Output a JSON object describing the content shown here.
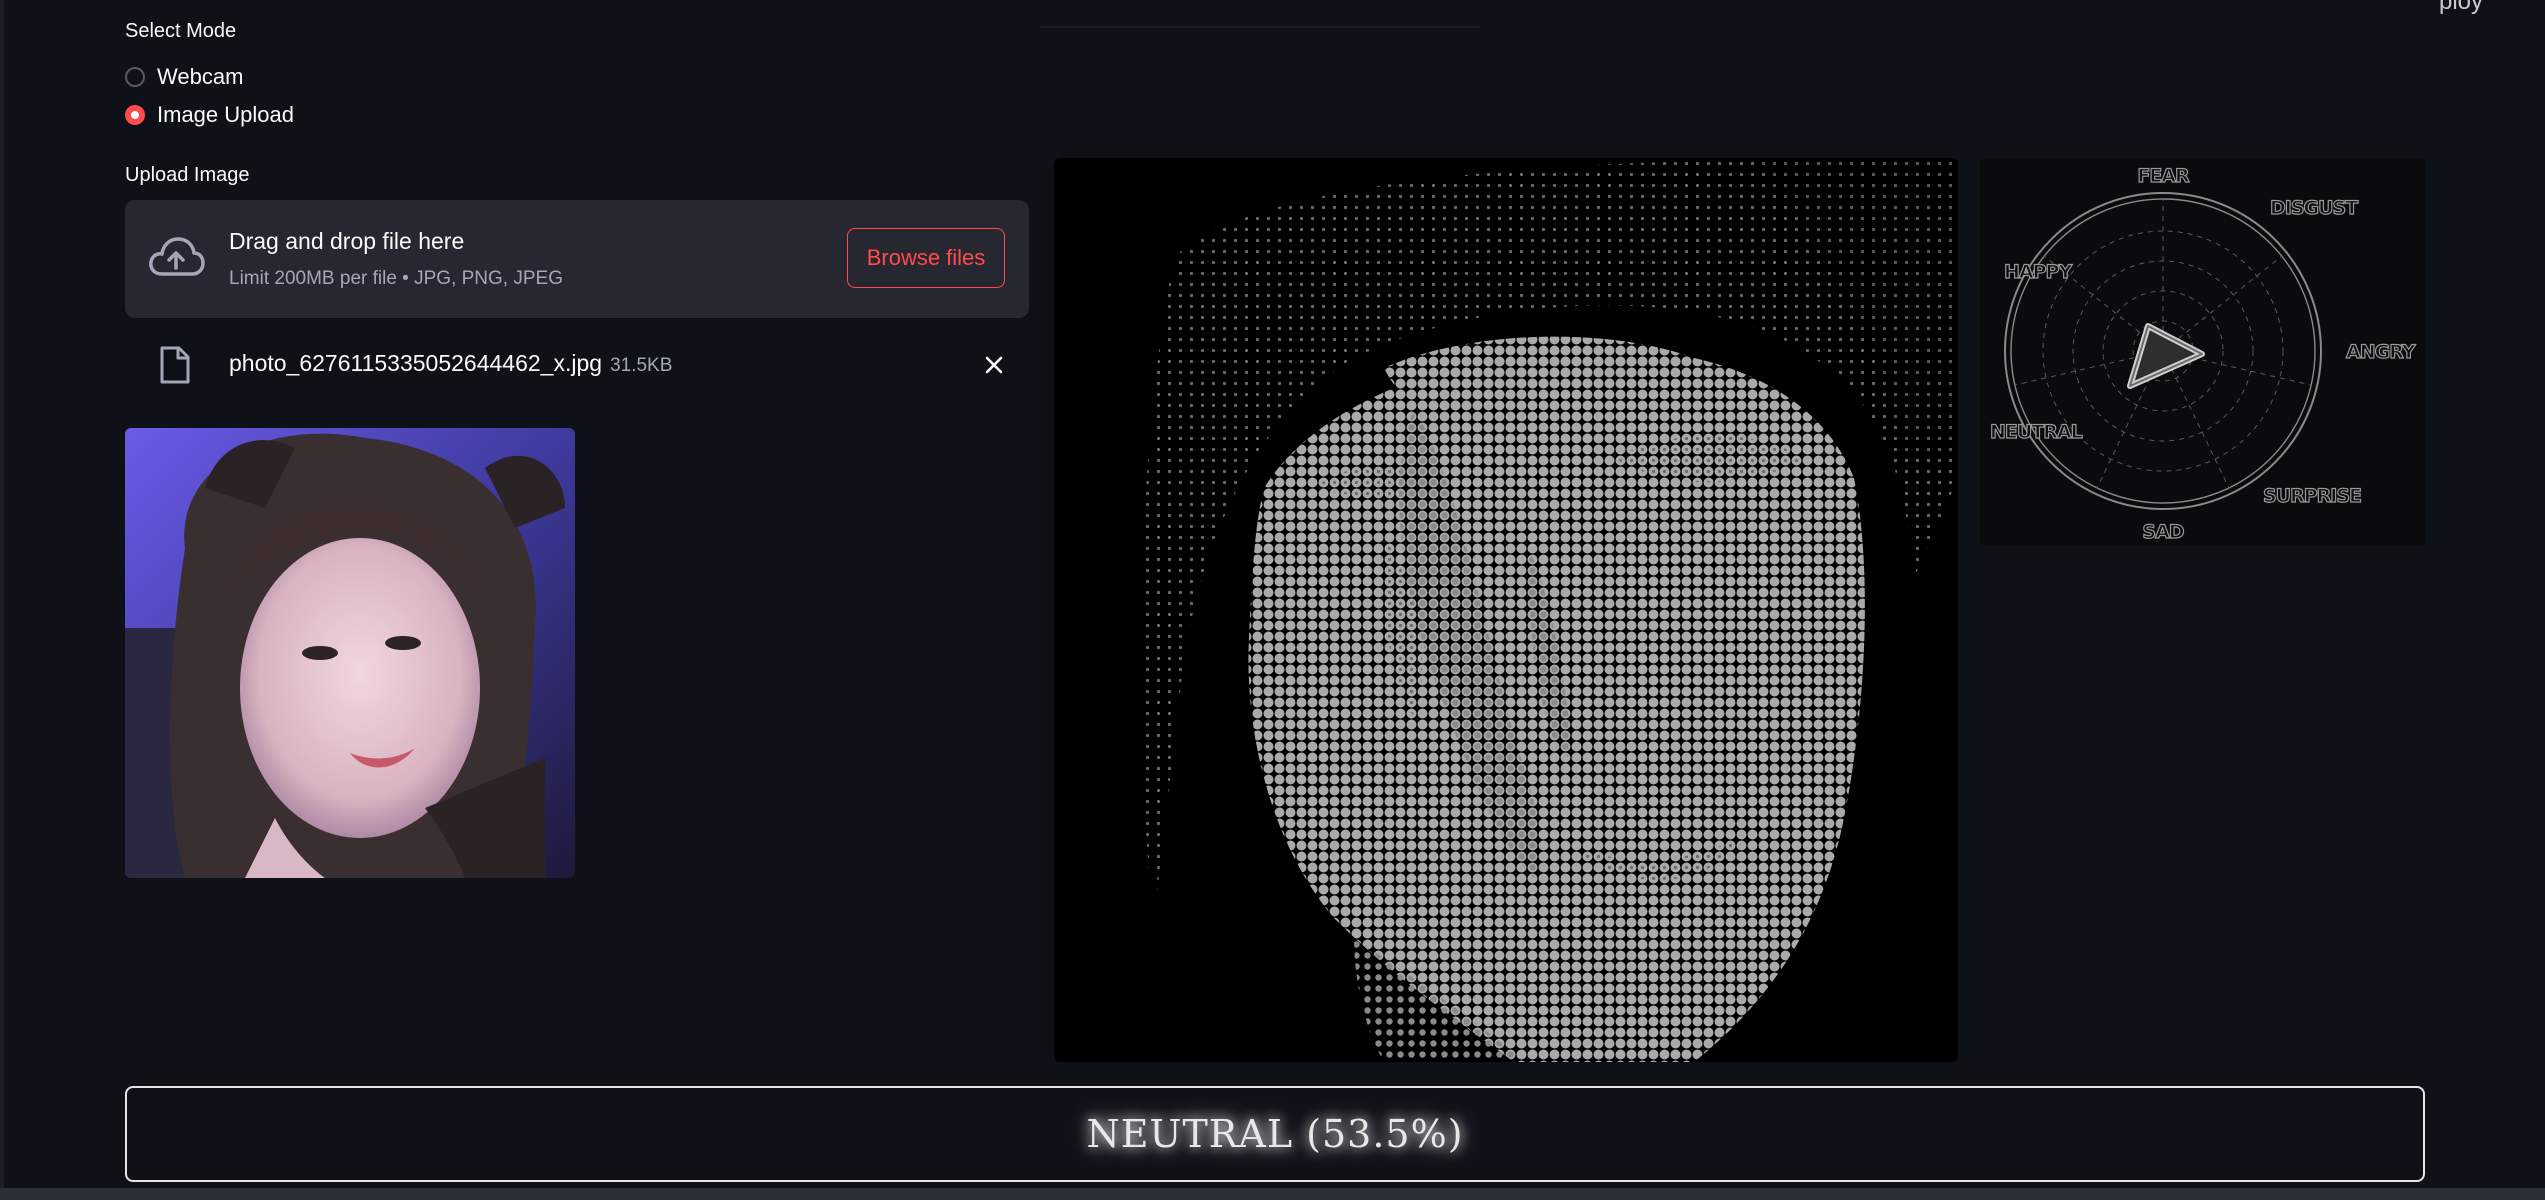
{
  "corner": {
    "text": "ploy"
  },
  "mode": {
    "label": "Select Mode",
    "options": [
      {
        "label": "Webcam",
        "selected": false
      },
      {
        "label": "Image Upload",
        "selected": true
      }
    ]
  },
  "upload": {
    "label": "Upload Image",
    "drop_title": "Drag and drop file here",
    "drop_limit": "Limit 200MB per file • JPG, PNG, JPEG",
    "browse_label": "Browse files"
  },
  "file": {
    "name": "photo_6276115335052644462_x.jpg",
    "size": "31.5KB"
  },
  "radar": {
    "labels": {
      "fear": "FEAR",
      "disgust": "DISGUST",
      "angry": "ANGRY",
      "surprise": "SURPRISE",
      "sad": "SAD",
      "neutral": "NEUTRAL",
      "happy": "HAPPY"
    }
  },
  "result": {
    "text": "NEUTRAL (53.5%)"
  },
  "colors": {
    "background": "#0e1117",
    "accent": "#ff4b4b",
    "dropzone": "#262730",
    "muted_text": "#a3a8b8"
  }
}
